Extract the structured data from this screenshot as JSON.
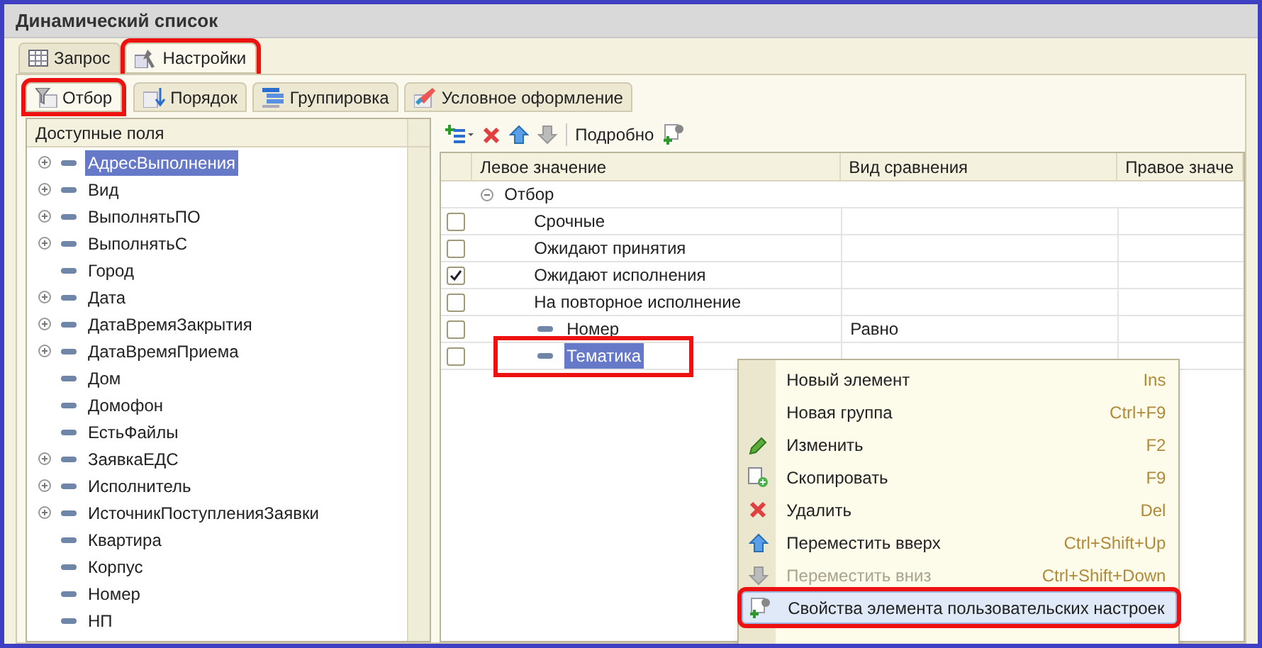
{
  "window": {
    "title": "Динамический список"
  },
  "tabs": [
    {
      "label": "Запрос",
      "selected": false,
      "highlighted": false
    },
    {
      "label": "Настройки",
      "selected": true,
      "highlighted": true
    }
  ],
  "subtabs": [
    {
      "label": "Отбор",
      "selected": true,
      "highlighted": true
    },
    {
      "label": "Порядок",
      "selected": false,
      "highlighted": false
    },
    {
      "label": "Группировка",
      "selected": false,
      "highlighted": false
    },
    {
      "label": "Условное оформление",
      "selected": false,
      "highlighted": false
    }
  ],
  "fields": {
    "title": "Доступные поля",
    "items": [
      {
        "label": "АдресВыполнения",
        "expandable": true,
        "selected": true
      },
      {
        "label": "Вид",
        "expandable": true,
        "selected": false
      },
      {
        "label": "ВыполнятьПО",
        "expandable": true,
        "selected": false
      },
      {
        "label": "ВыполнятьС",
        "expandable": true,
        "selected": false
      },
      {
        "label": "Город",
        "expandable": false,
        "selected": false
      },
      {
        "label": "Дата",
        "expandable": true,
        "selected": false
      },
      {
        "label": "ДатаВремяЗакрытия",
        "expandable": true,
        "selected": false
      },
      {
        "label": "ДатаВремяПриема",
        "expandable": true,
        "selected": false
      },
      {
        "label": "Дом",
        "expandable": false,
        "selected": false
      },
      {
        "label": "Домофон",
        "expandable": false,
        "selected": false
      },
      {
        "label": "ЕстьФайлы",
        "expandable": false,
        "selected": false
      },
      {
        "label": "ЗаявкаЕДС",
        "expandable": true,
        "selected": false
      },
      {
        "label": "Исполнитель",
        "expandable": true,
        "selected": false
      },
      {
        "label": "ИсточникПоступленияЗаявки",
        "expandable": true,
        "selected": false
      },
      {
        "label": "Квартира",
        "expandable": false,
        "selected": false
      },
      {
        "label": "Корпус",
        "expandable": false,
        "selected": false
      },
      {
        "label": "Номер",
        "expandable": false,
        "selected": false
      },
      {
        "label": "НП",
        "expandable": false,
        "selected": false
      }
    ]
  },
  "toolbar": {
    "details_label": "Подробно"
  },
  "table": {
    "columns": [
      "Левое значение",
      "Вид сравнения",
      "Правое значе"
    ],
    "group": {
      "label": "Отбор",
      "expanded": true
    },
    "rows": [
      {
        "kind": "group",
        "label": "Срочные",
        "checked": false
      },
      {
        "kind": "group",
        "label": "Ожидают принятия",
        "checked": false
      },
      {
        "kind": "group",
        "label": "Ожидают исполнения",
        "checked": true
      },
      {
        "kind": "group",
        "label": "На повторное исполнение",
        "checked": false
      },
      {
        "kind": "field",
        "label": "Номер",
        "comparison": "Равно",
        "checked": false,
        "selected": false,
        "highlighted": false
      },
      {
        "kind": "field",
        "label": "Тематика",
        "checked": false,
        "selected": true,
        "highlighted": true
      }
    ]
  },
  "context_menu": [
    {
      "label": "Новый элемент",
      "shortcut": "Ins",
      "disabled": false,
      "selected": false,
      "highlighted": false
    },
    {
      "label": "Новая группа",
      "shortcut": "Ctrl+F9",
      "disabled": false,
      "selected": false,
      "highlighted": false
    },
    {
      "label": "Изменить",
      "shortcut": "F2",
      "disabled": false,
      "selected": false,
      "highlighted": false
    },
    {
      "label": "Скопировать",
      "shortcut": "F9",
      "disabled": false,
      "selected": false,
      "highlighted": false
    },
    {
      "label": "Удалить",
      "shortcut": "Del",
      "disabled": false,
      "selected": false,
      "highlighted": false
    },
    {
      "label": "Переместить вверх",
      "shortcut": "Ctrl+Shift+Up",
      "disabled": false,
      "selected": false,
      "highlighted": false
    },
    {
      "label": "Переместить вниз",
      "shortcut": "Ctrl+Shift+Down",
      "disabled": true,
      "selected": false,
      "highlighted": false
    },
    {
      "label": "Свойства элемента пользовательских настроек",
      "disabled": false,
      "selected": true,
      "highlighted": true
    }
  ]
}
